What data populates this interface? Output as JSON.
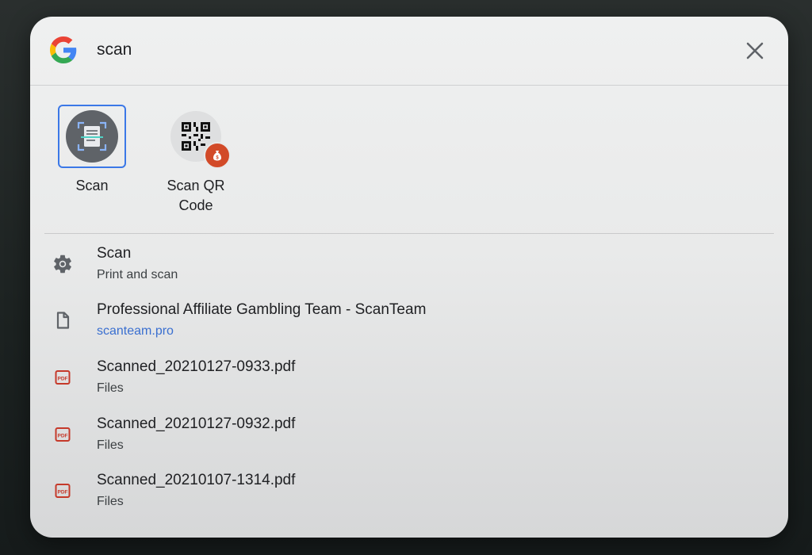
{
  "search": {
    "value": "scan",
    "placeholder": "",
    "google_icon": "google-g-logo",
    "close_icon": "close-icon"
  },
  "apps": [
    {
      "label": "Scan",
      "icon": "document-scanner-icon",
      "selected": true
    },
    {
      "label": "Scan QR\nCode",
      "icon": "qr-code-icon",
      "badge_icon": "money-bag-badge-icon"
    }
  ],
  "results": [
    {
      "title": "Scan",
      "subtitle": "Print and scan",
      "icon": "gear-icon",
      "subtitle_is_link": false
    },
    {
      "title": "Professional Affiliate Gambling Team - ScanTeam",
      "subtitle": "scanteam.pro",
      "icon": "page-icon",
      "subtitle_is_link": true
    },
    {
      "title": "Scanned_20210127-0933.pdf",
      "subtitle": "Files",
      "icon": "pdf-file-icon",
      "subtitle_is_link": false
    },
    {
      "title": "Scanned_20210127-0932.pdf",
      "subtitle": "Files",
      "icon": "pdf-file-icon",
      "subtitle_is_link": false
    },
    {
      "title": "Scanned_20210107-1314.pdf",
      "subtitle": "Files",
      "icon": "pdf-file-icon",
      "subtitle_is_link": false
    }
  ],
  "colors": {
    "accent": "#3b78e7",
    "link": "#3a6fd0",
    "badge": "#d24a28",
    "pdf": "#c5392a"
  }
}
